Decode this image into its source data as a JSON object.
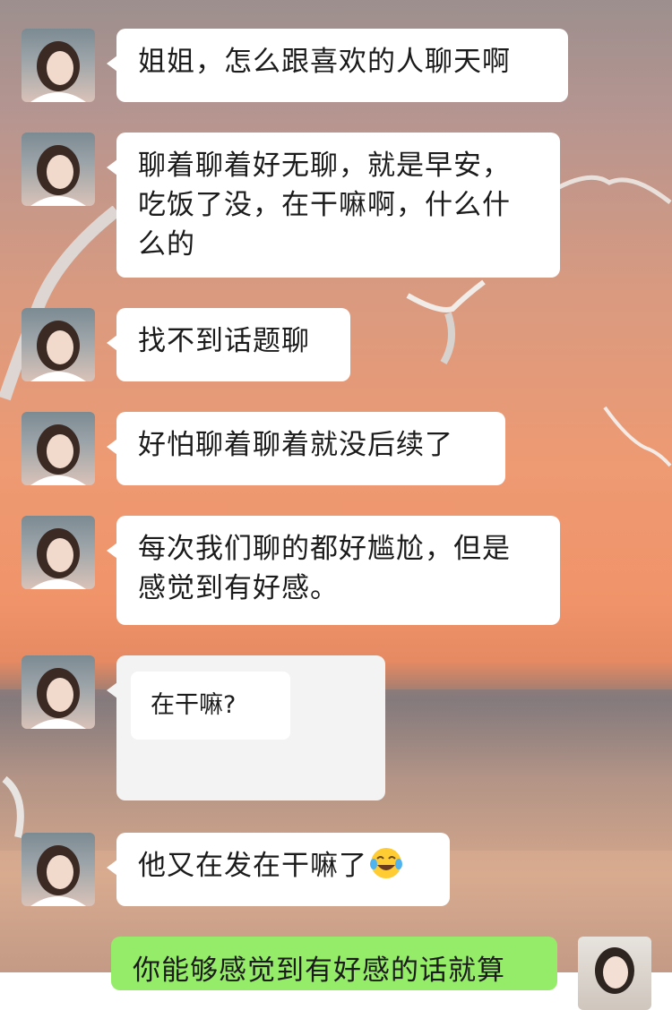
{
  "messages": [
    {
      "sender": "other",
      "text": "姐姐，怎么跟喜欢的人聊天啊"
    },
    {
      "sender": "other",
      "text": "聊着聊着好无聊，就是早安，吃饭了没，在干嘛啊，什么什么的"
    },
    {
      "sender": "other",
      "text": "找不到话题聊"
    },
    {
      "sender": "other",
      "text": "好怕聊着聊着就没后续了"
    },
    {
      "sender": "other",
      "text": "每次我们聊的都好尴尬，但是感觉到有好感。"
    },
    {
      "sender": "other",
      "type": "image",
      "text": "在干嘛?"
    },
    {
      "sender": "other",
      "text": "他又在发在干嘛了",
      "emoji": "tears-of-joy-emoji"
    },
    {
      "sender": "self",
      "text": "你能够感觉到有好感的话就算"
    }
  ],
  "colors": {
    "incoming_bubble": "#ffffff",
    "outgoing_bubble": "#95ec69",
    "text": "#1b1b1b"
  }
}
